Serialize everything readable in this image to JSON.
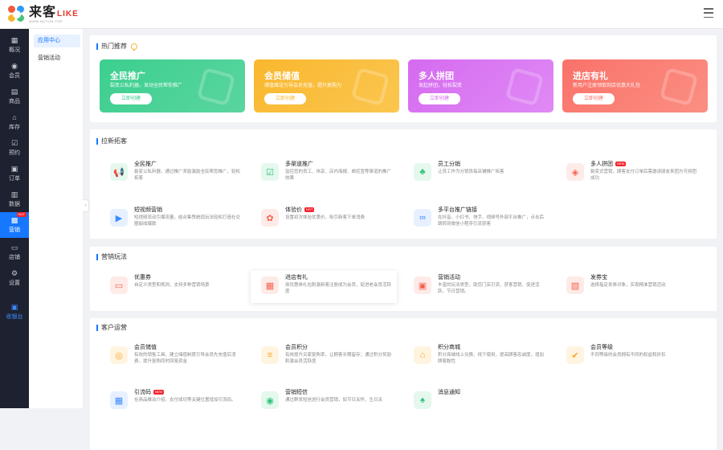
{
  "logo": {
    "main": "来客",
    "accent": "LIKE",
    "sub": "WWW.BOYUN.TOP"
  },
  "sidebar": {
    "items": [
      {
        "label": "概况",
        "icon": "grid-icon",
        "glyph": "▦"
      },
      {
        "label": "会员",
        "icon": "user-icon",
        "glyph": "◉"
      },
      {
        "label": "商品",
        "icon": "bag-icon",
        "glyph": "▤"
      },
      {
        "label": "库存",
        "icon": "home-icon",
        "glyph": "⌂"
      },
      {
        "label": "预约",
        "icon": "calendar-check-icon",
        "glyph": "☑"
      },
      {
        "label": "订单",
        "icon": "order-icon",
        "glyph": "▣"
      },
      {
        "label": "数据",
        "icon": "data-icon",
        "glyph": "▥"
      },
      {
        "label": "营销",
        "icon": "marketing-icon",
        "glyph": "▩",
        "badge": "HOT"
      },
      {
        "label": "店铺",
        "icon": "shop-icon",
        "glyph": "▭"
      },
      {
        "label": "设置",
        "icon": "gear-icon",
        "glyph": "⚙"
      },
      {
        "label": "收银台",
        "icon": "cashier-icon",
        "glyph": "▣"
      }
    ]
  },
  "subnav": {
    "items": [
      "应用中心",
      "营销活动"
    ]
  },
  "hot": {
    "title": "热门推荐",
    "banners": [
      {
        "title": "全民推广",
        "sub": "裂变公私利器，发动全民帮你推广",
        "button": "立即创建",
        "color": "#3ccf8e",
        "color2": "#5ad5a0"
      },
      {
        "title": "会员储值",
        "sub": "储值赠送引导会员充值，提升复购力",
        "button": "立即创建",
        "color": "#f9b72e",
        "color2": "#fbc64f"
      },
      {
        "title": "多人拼团",
        "sub": "发起拼团，轻松裂变",
        "button": "立即创建",
        "color": "#d56af0",
        "color2": "#e08af5"
      },
      {
        "title": "进店有礼",
        "sub": "新用户注册领取到店优惠大礼包",
        "button": "立即创建",
        "color": "#f9726a",
        "color2": "#fb8f82"
      }
    ]
  },
  "sections": [
    {
      "title": "拉新拓客",
      "cards": [
        {
          "title": "全民推广",
          "desc": "裂变公私利器，通过推广奖励激励全民帮您推广，轻松拓客",
          "icon": "megaphone-icon",
          "glyph": "📢",
          "color": "#2fc27b",
          "bg": "#e5f8ee"
        },
        {
          "title": "多渠道推广",
          "desc": "监控您的员工、伟享、店内海报、邮控宣等渠道的推广效果",
          "icon": "channel-icon",
          "glyph": "☑",
          "color": "#2fc27b",
          "bg": "#e5f8ee"
        },
        {
          "title": "员工分销",
          "desc": "让员工作为分销员每店铺推广拓客",
          "icon": "org-icon",
          "glyph": "♣",
          "color": "#2fc27b",
          "bg": "#e5f8ee"
        },
        {
          "title": "多人拼团",
          "badge": "NEW",
          "desc": "裂变式营销，顾客支付订单后需邀请朋友来团方可拼团成功",
          "icon": "group-buy-icon",
          "glyph": "◈",
          "color": "#f5624f",
          "bg": "#feebe8"
        },
        {
          "title": "短视频营销",
          "desc": "短视频流动引爆流量，结合集赞统现玩法轻松打造社交圈裂成爆款",
          "icon": "video-icon",
          "glyph": "▶",
          "color": "#3d8bff",
          "bg": "#e7f0ff"
        },
        {
          "title": "体验价",
          "badge": "HOT",
          "desc": "设置初次体验优惠价，吸引新客下单消费",
          "icon": "price-tag-icon",
          "glyph": "✿",
          "color": "#f5624f",
          "bg": "#feebe8"
        },
        {
          "title": "多平台推广链接",
          "desc": "在抖音、小红书、快手、视频号外部平台推广，点击后跳转到微信小程序引流获客",
          "icon": "link-icon",
          "glyph": "∞",
          "color": "#3d8bff",
          "bg": "#e7f0ff"
        }
      ]
    },
    {
      "title": "营销玩法",
      "cards": [
        {
          "title": "优惠券",
          "desc": "自定义类型和规则，支持多种营销场景",
          "icon": "coupon-icon",
          "glyph": "▭",
          "color": "#f5624f",
          "bg": "#feebe8"
        },
        {
          "title": "进店有礼",
          "desc": "用优惠券礼包刺激新客注册成为会员，促进老会员活跃度",
          "icon": "gift-icon",
          "glyph": "▦",
          "color": "#f5624f",
          "bg": "#feebe8"
        },
        {
          "title": "营销活动",
          "desc": "丰富的玩法类型，助您门店引流、获客营销、促进活跃、节日营销。",
          "icon": "activity-icon",
          "glyph": "▣",
          "color": "#f5624f",
          "bg": "#feebe8"
        },
        {
          "title": "发券宝",
          "desc": "选择指定发券对象，实现精准营销活动",
          "icon": "voucher-icon",
          "glyph": "▧",
          "color": "#f5624f",
          "bg": "#feebe8"
        }
      ]
    },
    {
      "title": "客户运营",
      "cards": [
        {
          "title": "会员储值",
          "desc": "有效的销售工具，建立储值制度引导会员先充值后消费，提升复购同时回笼资金",
          "icon": "deposit-icon",
          "glyph": "◎",
          "color": "#f6a623",
          "bg": "#fff4e0"
        },
        {
          "title": "会员积分",
          "desc": "有效提升买家复购率，让顾客长期留存；通过积分奖励刺激会员活跃度",
          "icon": "points-icon",
          "glyph": "≡",
          "color": "#f6a623",
          "bg": "#fff4e0"
        },
        {
          "title": "积分商城",
          "desc": "积分商城线上兑换、线下使用，提高顾客忠诚度，增加顾客黏性",
          "icon": "points-mall-icon",
          "glyph": "⌂",
          "color": "#f6a623",
          "bg": "#fff4e0"
        },
        {
          "title": "会员等级",
          "desc": "不同等级的会员拥有不同的权益和折扣",
          "icon": "vip-level-icon",
          "glyph": "✔",
          "color": "#f6a623",
          "bg": "#fff4e0"
        },
        {
          "title": "引流码",
          "badge": "NEW",
          "desc": "在商品推动介绍、支付成功等关键位置增加引流码。",
          "icon": "qr-code-icon",
          "glyph": "▦",
          "color": "#3d8bff",
          "bg": "#e7f0ff"
        },
        {
          "title": "营销短信",
          "desc": "通过群发短信进行会员营销，如节日关怀、生日关",
          "icon": "sms-icon",
          "glyph": "◉",
          "color": "#2fc27b",
          "bg": "#e5f8ee"
        },
        {
          "title": "消息通知",
          "desc": "",
          "icon": "bell-icon",
          "glyph": "♠",
          "color": "#2fc27b",
          "bg": "#e5f8ee"
        }
      ]
    }
  ]
}
